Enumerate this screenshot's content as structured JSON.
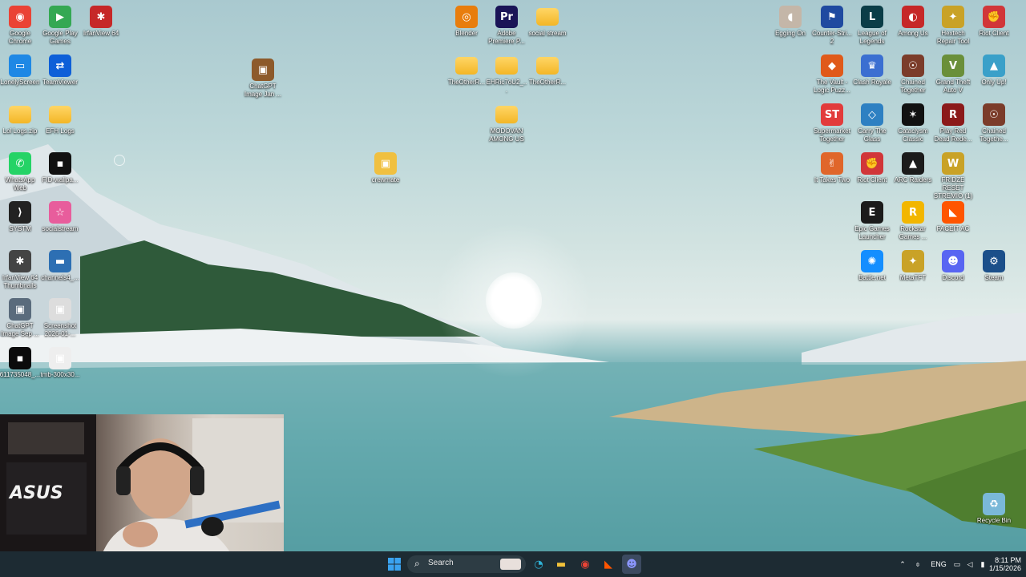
{
  "desktop": {
    "icons": [
      {
        "label": "Google Chrome",
        "glyph": "◉",
        "bg": "#ea4335"
      },
      {
        "label": "Google Play Games",
        "glyph": "▶",
        "bg": "#34a853"
      },
      {
        "label": "IrfanView 64",
        "glyph": "✱",
        "bg": "#c62828"
      },
      {
        "label": "LonelyScreen",
        "glyph": "▭",
        "bg": "#1e88e5"
      },
      {
        "label": "TeamViewer",
        "glyph": "⇄",
        "bg": "#0e5fd8"
      },
      {
        "label": "ChatGPT Image Jan ...",
        "glyph": "▣",
        "bg": "#8d5a2b"
      },
      {
        "label": "Lol Logs.zip",
        "glyph": "",
        "bg": ""
      },
      {
        "label": "EFH Logs",
        "glyph": "",
        "bg": ""
      },
      {
        "label": "WhatsApp Web",
        "glyph": "✆",
        "bg": "#25d366"
      },
      {
        "label": "FID-wallpa...",
        "glyph": "▪",
        "bg": "#111111"
      },
      {
        "label": "SYSTM",
        "glyph": "⟩",
        "bg": "#222222"
      },
      {
        "label": "socialstream",
        "glyph": "☆",
        "bg": "#e85d9c"
      },
      {
        "label": "IrfanView 64 Thumbnails",
        "glyph": "✱",
        "bg": "#444444"
      },
      {
        "label": "channels4_...",
        "glyph": "▬",
        "bg": "#2d6fb3"
      },
      {
        "label": "ChatGPT Image Sep ...",
        "glyph": "▣",
        "bg": "#5a6b7c"
      },
      {
        "label": "Screenshot 2026-01-...",
        "glyph": "▣",
        "bg": "#dddddd"
      },
      {
        "label": "611735048_...",
        "glyph": "▪",
        "bg": "#0b0b0b"
      },
      {
        "label": "tmb-300x30...",
        "glyph": "▣",
        "bg": "#eeeeee"
      },
      {
        "label": "crewmate",
        "glyph": "▣",
        "bg": "#f0c040"
      },
      {
        "label": "Blender",
        "glyph": "◎",
        "bg": "#e87d0d"
      },
      {
        "label": "Adobe Premiere P...",
        "glyph": "Pr",
        "bg": "#1a1457"
      },
      {
        "label": "social stream",
        "glyph": "",
        "bg": ""
      },
      {
        "label": "TheOtherR...",
        "glyph": "",
        "bg": ""
      },
      {
        "label": "EHRic7oU2_...",
        "glyph": "",
        "bg": ""
      },
      {
        "label": "TheOtherR...",
        "glyph": "",
        "bg": ""
      },
      {
        "label": "MODOVAN AMONG US",
        "glyph": "",
        "bg": ""
      },
      {
        "label": "Egging On",
        "glyph": "◖",
        "bg": "#c4b6a8"
      },
      {
        "label": "Counter-Stri... 2",
        "glyph": "⚑",
        "bg": "#1f4aa0"
      },
      {
        "label": "League of Legends",
        "glyph": "L",
        "bg": "#0a3d47"
      },
      {
        "label": "Among Us",
        "glyph": "◐",
        "bg": "#c62828"
      },
      {
        "label": "Hextech Repair Tool",
        "glyph": "✦",
        "bg": "#c9a227"
      },
      {
        "label": "Riot Client",
        "glyph": "✊",
        "bg": "#d13639"
      },
      {
        "label": "The Vault - Logic Puzz...",
        "glyph": "◆",
        "bg": "#e05a1a"
      },
      {
        "label": "Clash Royale",
        "glyph": "♛",
        "bg": "#3b6fd1"
      },
      {
        "label": "Chained Together",
        "glyph": "☉",
        "bg": "#7b3c2a"
      },
      {
        "label": "Grand Theft Auto V",
        "glyph": "V",
        "bg": "#6a8f3a"
      },
      {
        "label": "Only Up!",
        "glyph": "▲",
        "bg": "#3aa0c9"
      },
      {
        "label": "Supermarket Together",
        "glyph": "ST",
        "bg": "#e23b3b"
      },
      {
        "label": "Carry The Glass",
        "glyph": "◇",
        "bg": "#2e80c2"
      },
      {
        "label": "Cataclysm Classic",
        "glyph": "✶",
        "bg": "#111111"
      },
      {
        "label": "Play Red Dead Rede...",
        "glyph": "R",
        "bg": "#8b1a1a"
      },
      {
        "label": "Chained Togethe...",
        "glyph": "☉",
        "bg": "#7b3c2a"
      },
      {
        "label": "It Takes Two",
        "glyph": "✌",
        "bg": "#e0662a"
      },
      {
        "label": "Riot Client",
        "glyph": "✊",
        "bg": "#d13639"
      },
      {
        "label": "ARC Raiders",
        "glyph": "▲",
        "bg": "#1b1b1b"
      },
      {
        "label": "FRIDZE RESET STREMIO (1)",
        "glyph": "W",
        "bg": "#c9a227"
      },
      {
        "label": "Epic Games Launcher",
        "glyph": "E",
        "bg": "#1b1b1b"
      },
      {
        "label": "Rockstar Games ...",
        "glyph": "R",
        "bg": "#f2b600"
      },
      {
        "label": "FACEIT AC",
        "glyph": "◣",
        "bg": "#ff5500"
      },
      {
        "label": "Battle.net",
        "glyph": "✺",
        "bg": "#148eff"
      },
      {
        "label": "MetaTFT",
        "glyph": "✦",
        "bg": "#c9a227"
      },
      {
        "label": "Discord",
        "glyph": "☻",
        "bg": "#5865f2"
      },
      {
        "label": "Steam",
        "glyph": "⚙",
        "bg": "#1b4f8a"
      },
      {
        "label": "Recycle Bin",
        "glyph": "♻",
        "bg": "#7ab8d8"
      }
    ]
  },
  "taskbar": {
    "start_icon": "windows-start-icon",
    "search_placeholder": "Search",
    "tray": {
      "language": "ENG",
      "time": "8:11 PM",
      "date": "1/15/2026"
    }
  }
}
